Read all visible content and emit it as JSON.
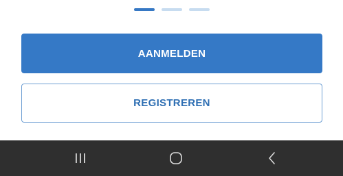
{
  "pager": {
    "count": 3,
    "active_index": 0
  },
  "actions": {
    "login_label": "AANMELDEN",
    "register_label": "REGISTREREN"
  },
  "system_nav": {
    "recent_icon": "recent-apps-icon",
    "home_icon": "home-icon",
    "back_icon": "back-icon"
  },
  "colors": {
    "accent": "#3579c6",
    "pager_inactive": "#c7dcf0",
    "navbar_bg": "#2f2f2f"
  }
}
